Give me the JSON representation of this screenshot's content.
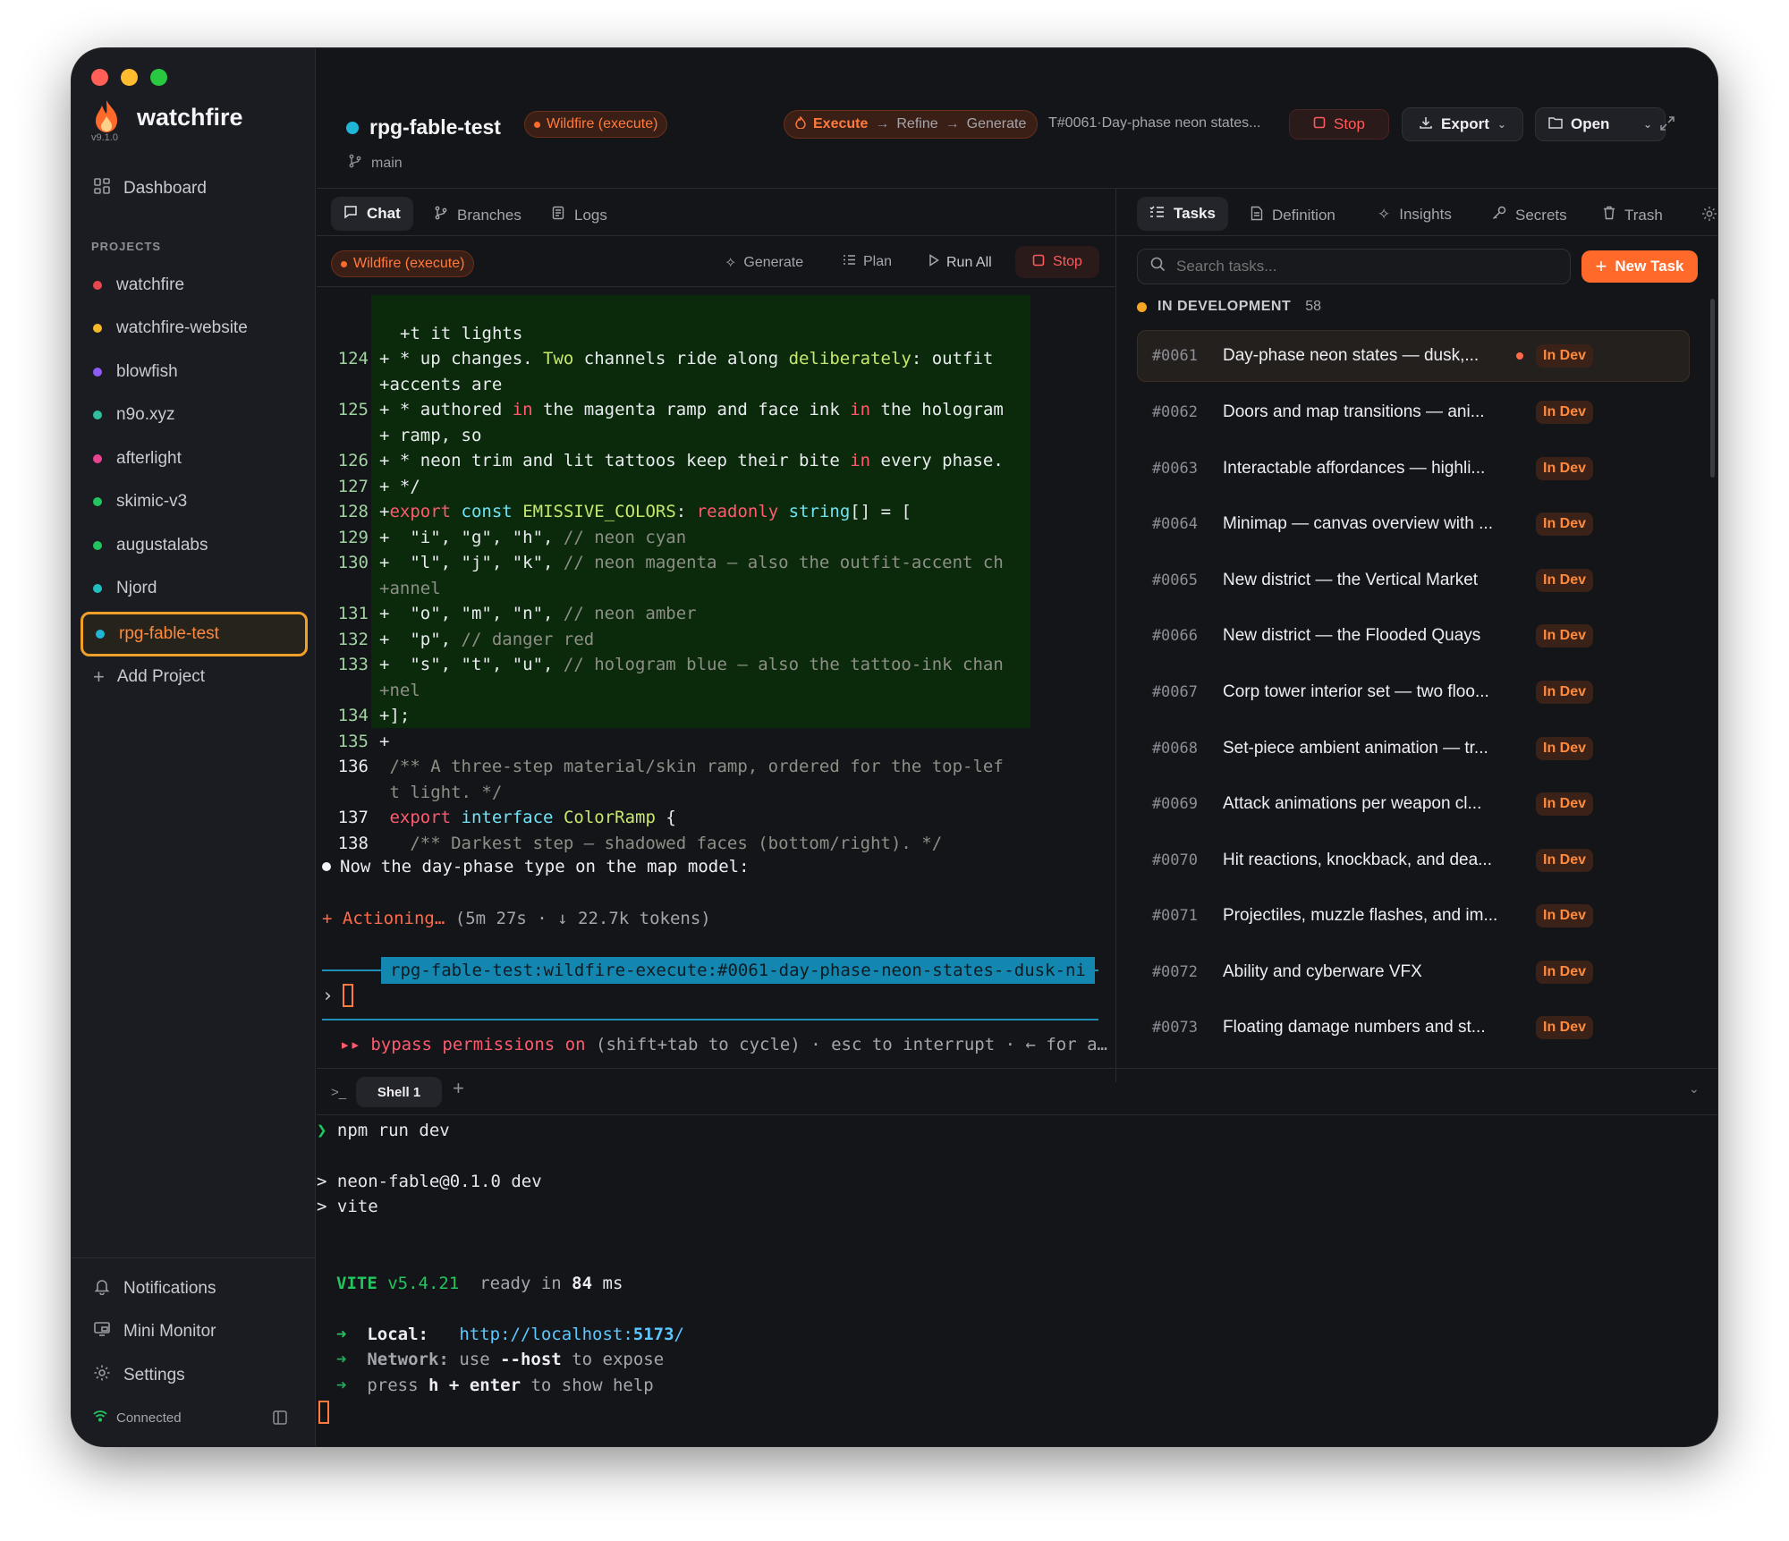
{
  "app": {
    "name": "watchfire",
    "version": "v9.1.0"
  },
  "sidebar": {
    "dashboard": "Dashboard",
    "projects_heading": "PROJECTS",
    "projects": [
      {
        "label": "watchfire",
        "color": "#e5484d"
      },
      {
        "label": "watchfire-website",
        "color": "#f5b829"
      },
      {
        "label": "blowfish",
        "color": "#8b5cf6"
      },
      {
        "label": "n9o.xyz",
        "color": "#2fbf9f"
      },
      {
        "label": "afterlight",
        "color": "#e84393"
      },
      {
        "label": "skimic-v3",
        "color": "#22c55e"
      },
      {
        "label": "augustalabs",
        "color": "#22c55e"
      },
      {
        "label": "Njord",
        "color": "#1fbfbf"
      },
      {
        "label": "rpg-fable-test",
        "color": "#1fb5d6"
      }
    ],
    "add_project": "Add Project",
    "notifications": "Notifications",
    "mini_monitor": "Mini Monitor",
    "settings": "Settings",
    "connected": "Connected"
  },
  "header": {
    "project": "rpg-fable-test",
    "mode_badge": "Wildfire (execute)",
    "branch": "main",
    "steps": [
      "Execute",
      "Refine",
      "Generate"
    ],
    "task_ref": "T#0061·Day-phase neon states...",
    "stop": "Stop",
    "export": "Export",
    "open": "Open"
  },
  "center": {
    "tabs": [
      "Chat",
      "Branches",
      "Logs"
    ],
    "mode_badge": "Wildfire (execute)",
    "actions": {
      "generate": "Generate",
      "plan": "Plan",
      "run_all": "Run All",
      "stop": "Stop"
    }
  },
  "chat": {
    "diff_lines": [
      {
        "num": "",
        "text": "+t it lights"
      },
      {
        "num": "124",
        "text": "+ * up changes. Two channels ride along deliberately: outfit"
      },
      {
        "num": "",
        "text": "+accents are"
      },
      {
        "num": "125",
        "text": "+ * authored in the magenta ramp and face ink in the hologram"
      },
      {
        "num": "",
        "text": "+ ramp, so"
      },
      {
        "num": "126",
        "text": "+ * neon trim and lit tattoos keep their bite in every phase."
      },
      {
        "num": "127",
        "text": "+ */"
      },
      {
        "num": "128",
        "text": "+export const EMISSIVE_COLORS: readonly string[] = ["
      },
      {
        "num": "129",
        "text": "+  \"i\", \"g\", \"h\", // neon cyan"
      },
      {
        "num": "130",
        "text": "+  \"l\", \"j\", \"k\", // neon magenta — also the outfit-accent ch"
      },
      {
        "num": "",
        "text": "+annel"
      },
      {
        "num": "131",
        "text": "+  \"o\", \"m\", \"n\", // neon amber"
      },
      {
        "num": "132",
        "text": "+  \"p\", // danger red"
      },
      {
        "num": "133",
        "text": "+  \"s\", \"t\", \"u\", // hologram blue — also the tattoo-ink chan"
      },
      {
        "num": "",
        "text": "+nel"
      },
      {
        "num": "134",
        "text": "+];"
      },
      {
        "num": "135",
        "text": "+"
      }
    ],
    "context_lines": [
      {
        "num": "136",
        "text": " /** A three-step material/skin ramp, ordered for the top-lef"
      },
      {
        "num": "",
        "text": " t light. */"
      },
      {
        "num": "137",
        "text": " export interface ColorRamp {"
      },
      {
        "num": "138",
        "text": "   /** Darkest step — shadowed faces (bottom/right). */"
      }
    ],
    "message": "Now the day-phase type on the map model:",
    "status_action": "Actioning…",
    "status_meta": "(5m 27s · ↓ 22.7k tokens)",
    "session_label": "rpg-fable-test:wildfire-execute:#0061-day-phase-neon-states--dusk-ni",
    "prompt_symbol": "›",
    "bypass_on": "bypass permissions on",
    "bypass_hint": "(shift+tab to cycle) · esc to interrupt · ← for a…"
  },
  "right": {
    "tabs": [
      "Tasks",
      "Definition",
      "Insights",
      "Secrets",
      "Trash"
    ],
    "search_placeholder": "Search tasks...",
    "new_task": "New Task",
    "group_label": "IN DEVELOPMENT",
    "group_count": "58",
    "tasks": [
      {
        "id": "#0061",
        "title": "Day-phase neon states — dusk,...",
        "status": "In Dev",
        "active": true
      },
      {
        "id": "#0062",
        "title": "Doors and map transitions — ani...",
        "status": "In Dev"
      },
      {
        "id": "#0063",
        "title": "Interactable affordances — highli...",
        "status": "In Dev"
      },
      {
        "id": "#0064",
        "title": "Minimap — canvas overview with ...",
        "status": "In Dev"
      },
      {
        "id": "#0065",
        "title": "New district — the Vertical Market",
        "status": "In Dev"
      },
      {
        "id": "#0066",
        "title": "New district — the Flooded Quays",
        "status": "In Dev"
      },
      {
        "id": "#0067",
        "title": "Corp tower interior set — two floo...",
        "status": "In Dev"
      },
      {
        "id": "#0068",
        "title": "Set-piece ambient animation — tr...",
        "status": "In Dev"
      },
      {
        "id": "#0069",
        "title": "Attack animations per weapon cl...",
        "status": "In Dev"
      },
      {
        "id": "#0070",
        "title": "Hit reactions, knockback, and dea...",
        "status": "In Dev"
      },
      {
        "id": "#0071",
        "title": "Projectiles, muzzle flashes, and im...",
        "status": "In Dev"
      },
      {
        "id": "#0072",
        "title": "Ability and cyberware VFX",
        "status": "In Dev"
      },
      {
        "id": "#0073",
        "title": "Floating damage numbers and st...",
        "status": "In Dev"
      }
    ]
  },
  "terminal": {
    "tab": "Shell 1",
    "command": "npm run dev",
    "line1": "> neon-fable@0.1.0 dev",
    "line2": "> vite",
    "vite_name": "VITE",
    "vite_version": "v5.4.21",
    "ready_text": "ready in",
    "ready_ms": "84",
    "ready_unit": "ms",
    "local_label": "Local:",
    "local_url_prefix": "http://localhost:",
    "local_port": "5173",
    "local_url_suffix": "/",
    "network_label": "Network:",
    "network_pre": "use",
    "network_flag": "--host",
    "network_post": "to expose",
    "help_pre": "press",
    "help_key1": "h",
    "help_plus": "+",
    "help_key2": "enter",
    "help_post": "to show help"
  },
  "colors": {
    "accent": "#ff6a2b",
    "diff_bg": "#0b2a0b",
    "session_bg": "#1387b0"
  }
}
